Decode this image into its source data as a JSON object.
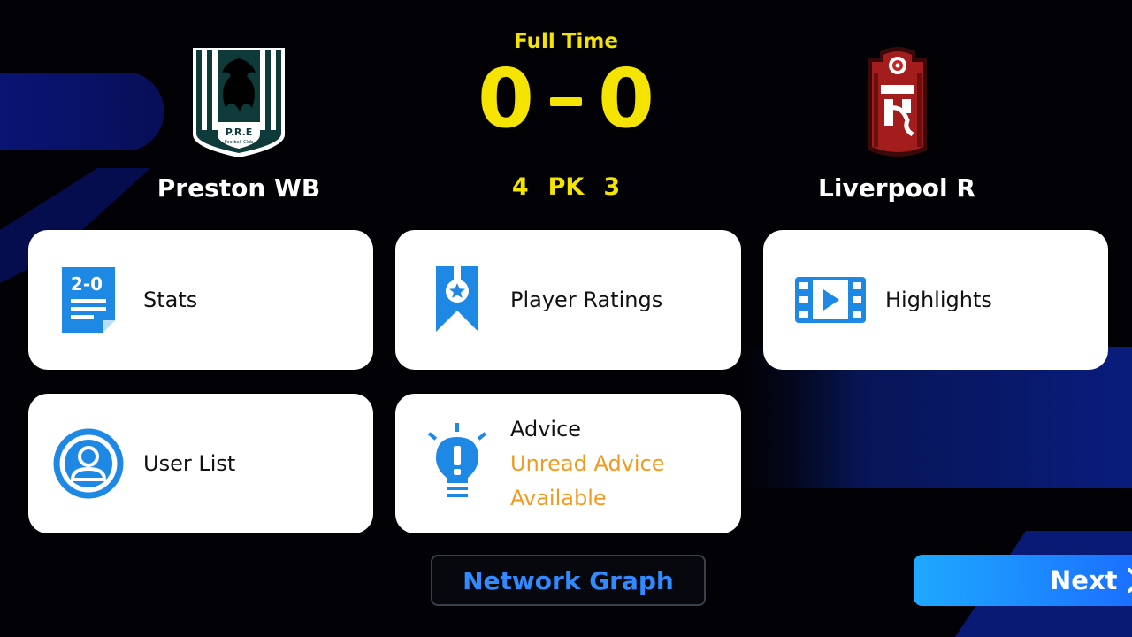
{
  "match": {
    "status": "Full Time",
    "home_score": "0",
    "away_score": "0",
    "pk_home": "4",
    "pk_label": "PK",
    "pk_away": "3"
  },
  "home_team": {
    "name": "Preston WB",
    "crest_text": "P.R.E",
    "crest_subtext": "Football Club"
  },
  "away_team": {
    "name": "Liverpool R"
  },
  "menu": {
    "stats": {
      "label": "Stats",
      "icon_text": "2-0",
      "icon": "stats-document-icon"
    },
    "player_ratings": {
      "label": "Player Ratings",
      "icon": "ribbon-star-icon"
    },
    "highlights": {
      "label": "Highlights",
      "icon": "film-play-icon"
    },
    "user_list": {
      "label": "User List",
      "icon": "user-circle-icon"
    },
    "advice": {
      "label": "Advice",
      "sub_line1": "Unread Advice",
      "sub_line2": "Available",
      "icon": "lightbulb-exclamation-icon"
    }
  },
  "footer": {
    "network_graph_label": "Network Graph",
    "next_label": "Next"
  },
  "colors": {
    "accent_yellow": "#f5e400",
    "icon_blue": "#1e88e5",
    "advice_orange": "#f29a1f",
    "button_blue": "#2f8bff"
  }
}
